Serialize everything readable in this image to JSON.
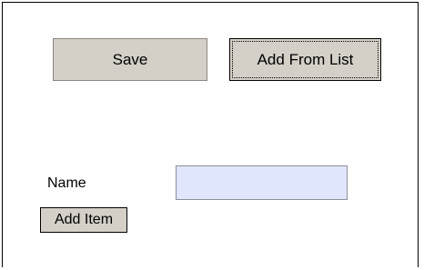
{
  "toolbar": {
    "save_label": "Save",
    "add_from_list_label": "Add From List"
  },
  "form": {
    "name_label": "Name",
    "name_value": "",
    "add_item_label": "Add Item"
  },
  "colors": {
    "button_face": "#d4d0c8",
    "input_background": "#e0e6fc",
    "panel_border": "#000000"
  }
}
